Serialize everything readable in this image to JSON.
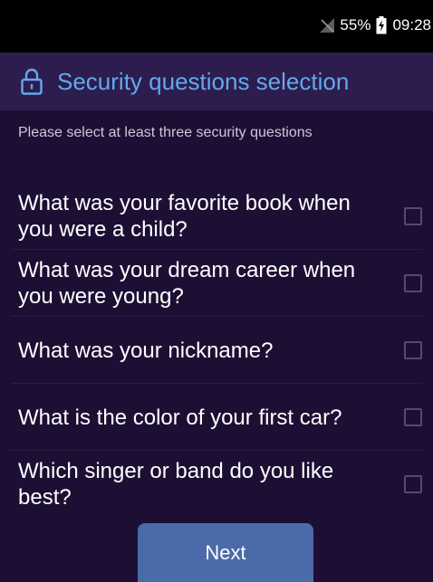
{
  "status_bar": {
    "battery_percent": "55%",
    "time": "09:28",
    "signal_icon": "no-signal-icon",
    "battery_icon": "battery-charging-icon"
  },
  "header": {
    "title": "Security questions selection",
    "icon": "lock-icon"
  },
  "instruction": "Please select at least three security questions",
  "questions": [
    {
      "text": "What was your favorite book when you were a child?",
      "checked": false
    },
    {
      "text": "What was your dream career when you were young?",
      "checked": false
    },
    {
      "text": "What was your nickname?",
      "checked": false
    },
    {
      "text": "What is the color of your first car?",
      "checked": false
    },
    {
      "text": "Which singer or band do you like best?",
      "checked": false
    }
  ],
  "next_button": {
    "label": "Next"
  },
  "colors": {
    "background": "#1d0f34",
    "header_background": "#2d1d4e",
    "accent": "#61a9eb",
    "button": "#4a6aa9"
  }
}
